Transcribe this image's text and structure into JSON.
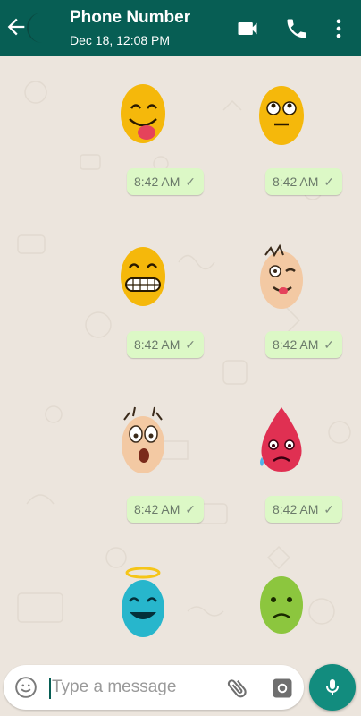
{
  "header": {
    "contact_name": "Phone Number",
    "last_seen": "Dec 18, 12:08 PM",
    "icons": [
      "back-arrow-icon",
      "video-call-icon",
      "voice-call-icon",
      "more-options-icon"
    ]
  },
  "messages": [
    {
      "sticker": "egg-tongue-out",
      "time": "8:42 AM",
      "status": "sent"
    },
    {
      "sticker": "egg-rolling-eyes",
      "time": "8:42 AM",
      "status": "sent"
    },
    {
      "sticker": "egg-grinning",
      "time": "8:42 AM",
      "status": "sent"
    },
    {
      "sticker": "egg-messy-winking",
      "time": "8:42 AM",
      "status": "sent"
    },
    {
      "sticker": "egg-shocked",
      "time": "8:42 AM",
      "status": "sent"
    },
    {
      "sticker": "egg-sad-red-tear",
      "time": "8:42 AM",
      "status": "sent"
    },
    {
      "sticker": "egg-angel-laughing"
    },
    {
      "sticker": "egg-green-frown"
    }
  ],
  "input": {
    "placeholder": "Type a message",
    "icons": [
      "emoji-icon",
      "attach-icon",
      "camera-icon",
      "mic-icon"
    ]
  },
  "colors": {
    "header": "#075e54",
    "chat_background": "#ece5dd",
    "bubble": "#dcf8c6",
    "mic_button": "#128c7e"
  }
}
